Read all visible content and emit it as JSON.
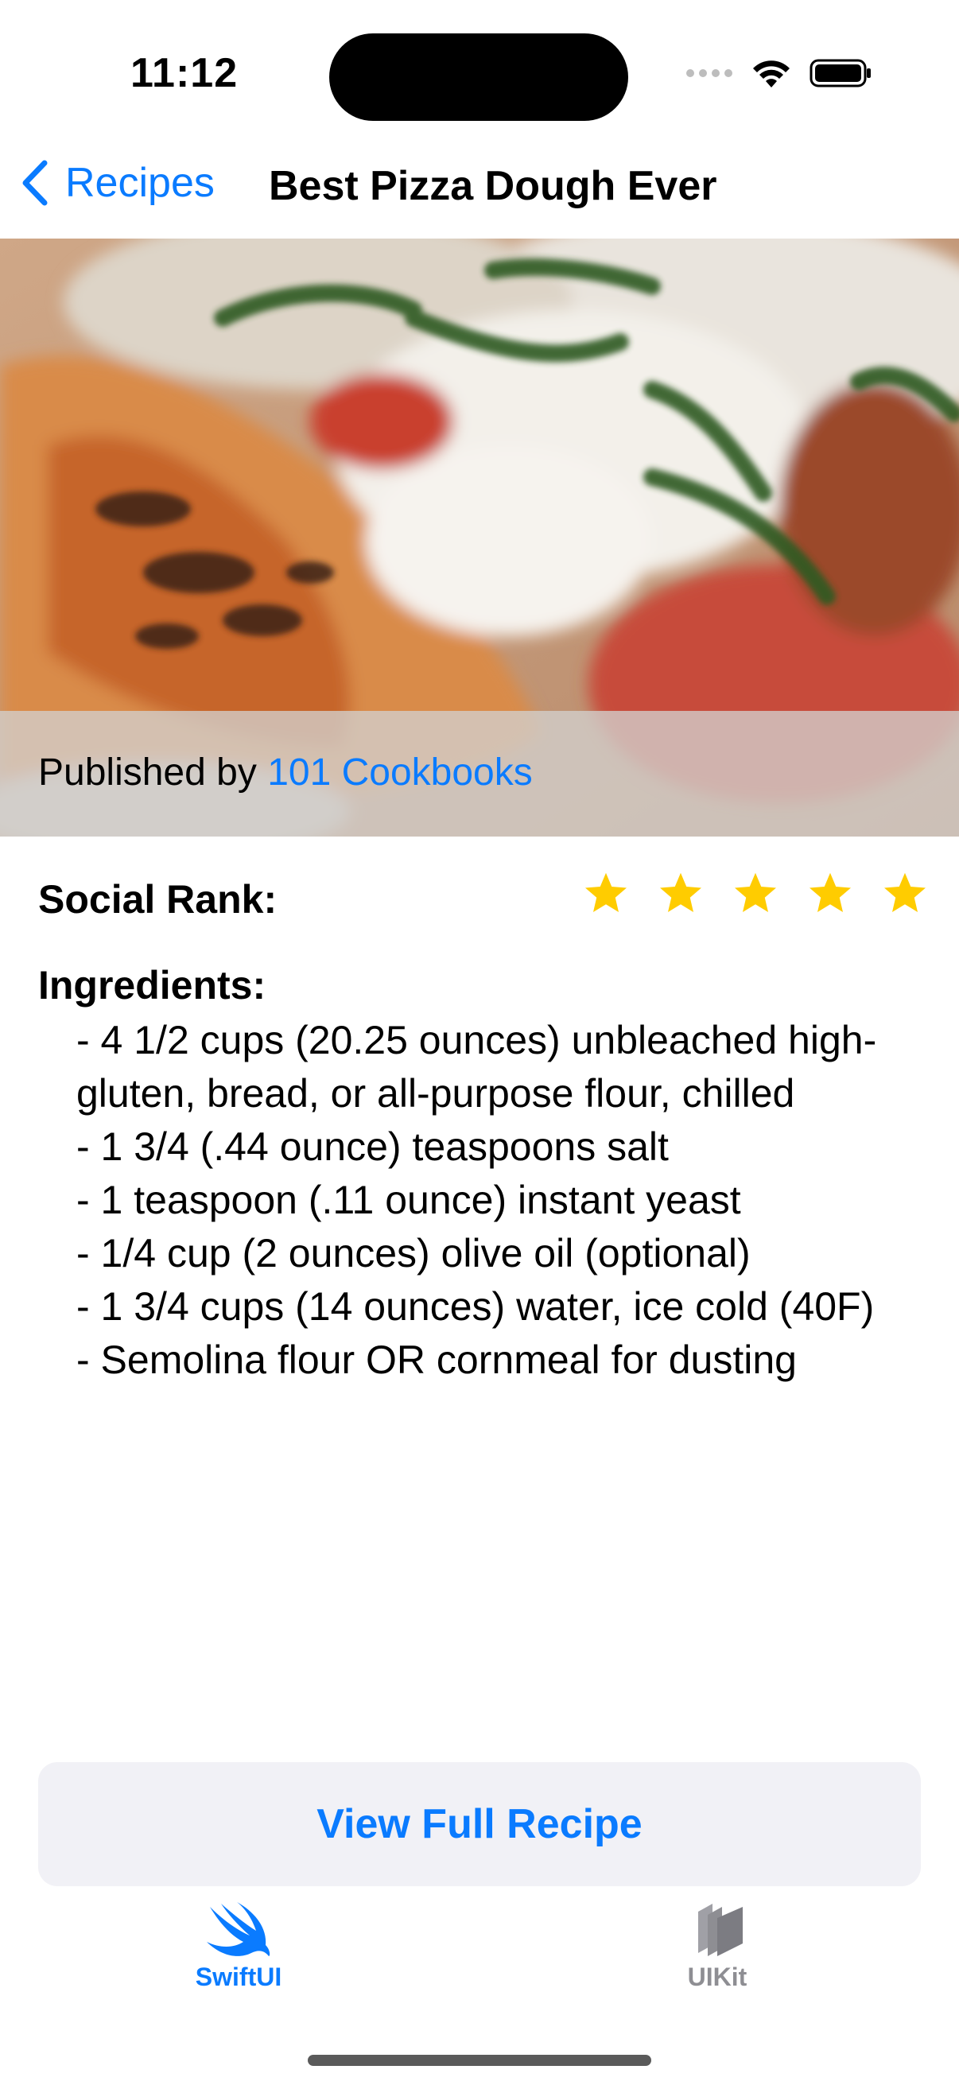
{
  "status_bar": {
    "time": "11:12",
    "icons": [
      "cellular-dots-icon",
      "wifi-icon",
      "battery-icon"
    ]
  },
  "nav": {
    "back_label": "Recipes",
    "title": "Best Pizza Dough Ever"
  },
  "hero": {
    "published_prefix": "Published by ",
    "publisher": "101 Cookbooks"
  },
  "social_rank": {
    "label": "Social Rank:",
    "stars": 5,
    "max_stars": 5,
    "star_color": "#ffcc00"
  },
  "ingredients": {
    "label": "Ingredients:",
    "items": [
      "- 4 1/2 cups (20.25 ounces) unbleached high-gluten, bread, or all-purpose flour, chilled",
      "- 1 3/4 (.44 ounce) teaspoons salt",
      "- 1 teaspoon (.11 ounce) instant yeast",
      "- 1/4 cup (2 ounces) olive oil (optional)",
      "- 1 3/4 cups (14 ounces) water, ice cold (40F)",
      "- Semolina flour OR cornmeal for dusting"
    ]
  },
  "view_button": {
    "label": "View Full Recipe"
  },
  "tabs": [
    {
      "label": "SwiftUI",
      "icon": "swift-bird-icon",
      "selected": true
    },
    {
      "label": "UIKit",
      "icon": "uikit-stack-icon",
      "selected": false
    }
  ],
  "colors": {
    "accent": "#0a7bff",
    "inactive": "#8e8e93"
  }
}
